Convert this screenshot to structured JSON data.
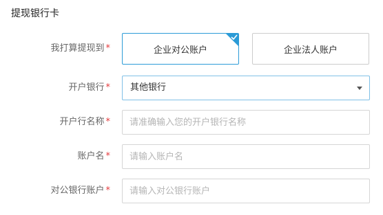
{
  "section_title": "提现银行卡",
  "required_mark": "*",
  "form": {
    "account_type": {
      "label": "我打算提现到",
      "options": [
        {
          "label": "企业对公账户",
          "selected": true
        },
        {
          "label": "企业法人账户",
          "selected": false
        }
      ]
    },
    "bank": {
      "label": "开户银行",
      "value": "其他银行"
    },
    "branch_name": {
      "label": "开户行名称",
      "value": "",
      "placeholder": "请准确输入您的开户银行名称"
    },
    "account_name": {
      "label": "账户名",
      "value": "",
      "placeholder": "请输入账户名"
    },
    "account_number": {
      "label": "对公银行账户",
      "value": "",
      "placeholder": "请输入对公银行账户"
    }
  },
  "colors": {
    "accent": "#2b9bd7",
    "required": "#e4393c",
    "placeholder": "#b5b5b5",
    "label": "#666666"
  },
  "icons": {
    "selected_corner": "checkmark-icon",
    "select_arrow": "caret-down-icon"
  }
}
